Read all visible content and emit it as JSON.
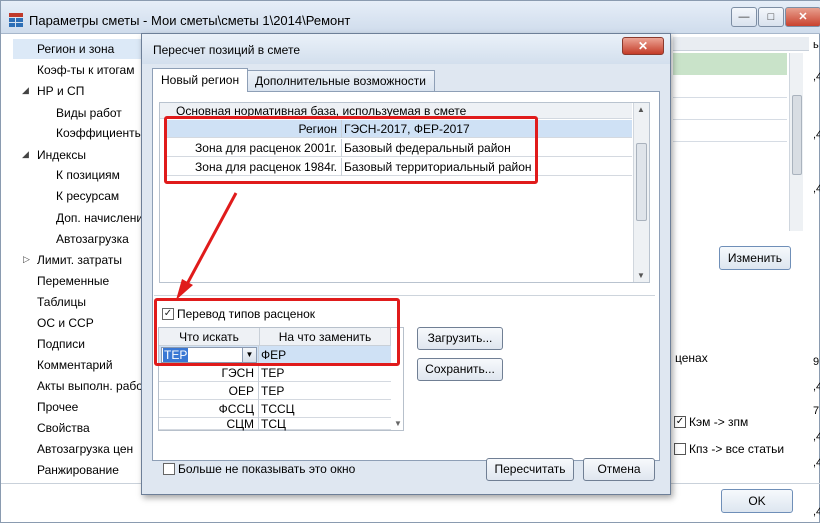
{
  "window": {
    "title": "Параметры сметы - Мои сметы\\сметы 1\\2014\\Ремонт",
    "min_glyph": "—",
    "max_glyph": "□",
    "close_glyph": "✕",
    "ok_label": "OK"
  },
  "sidebar": {
    "items": [
      {
        "label": "Регион и зона"
      },
      {
        "label": "Коэф-ты к итогам"
      },
      {
        "label": "НР и СП"
      },
      {
        "label": "Виды работ"
      },
      {
        "label": "Коэффициенты"
      },
      {
        "label": "Индексы"
      },
      {
        "label": "К позициям"
      },
      {
        "label": "К ресурсам"
      },
      {
        "label": "Доп. начислени"
      },
      {
        "label": "Автозагрузка"
      },
      {
        "label": "Лимит. затраты"
      },
      {
        "label": "Переменные"
      },
      {
        "label": "Таблицы"
      },
      {
        "label": "ОС и ССР"
      },
      {
        "label": "Подписи"
      },
      {
        "label": "Комментарий"
      },
      {
        "label": "Акты выполн. рабо"
      },
      {
        "label": "Прочее"
      },
      {
        "label": "Свойства"
      },
      {
        "label": "Автозагрузка цен"
      },
      {
        "label": "Ранжирование"
      }
    ]
  },
  "background": {
    "change_button": "Изменить",
    "text_tsenah": "ценах",
    "check_kem": "Кэм -> зпм",
    "check_kpz": "Кпз -> все статьи",
    "edge_marks": [
      "ь",
      ",4",
      ",4",
      ",4",
      "9,",
      ",4",
      "7,",
      ",4",
      ",4",
      ",4"
    ]
  },
  "dialog": {
    "title": "Пересчет позиций в смете",
    "close_glyph": "✕",
    "tabs": [
      "Новый регион",
      "Дополнительные возможности"
    ],
    "base_header": "Основная нормативная база, используемая в смете",
    "base_rows": [
      {
        "label": "Регион",
        "value": "ГЭСН-2017, ФЕР-2017"
      },
      {
        "label": "Зона для расценок 2001г.",
        "value": "Базовый федеральный район"
      },
      {
        "label": "Зона для расценок 1984г.",
        "value": "Базовый территориальный район"
      }
    ],
    "convert_checkbox_label": "Перевод типов расценок",
    "convert_checkbox_checked": true,
    "map_headers": [
      "Что искать",
      "На что заменить"
    ],
    "map_rows": [
      {
        "find": "ТЕР",
        "replace": "ФЕР"
      },
      {
        "find": "ГЭСН",
        "replace": "ТЕР"
      },
      {
        "find": "ОЕР",
        "replace": "ТЕР"
      },
      {
        "find": "ФССЦ",
        "replace": "ТССЦ"
      },
      {
        "find": "СЦМ",
        "replace": "ТСЦ"
      }
    ],
    "load_button": "Загрузить...",
    "save_button": "Сохранить...",
    "dont_show_label": "Больше не показывать это окно",
    "dont_show_checked": false,
    "recalc_button": "Пересчитать",
    "cancel_button": "Отмена"
  },
  "colors": {
    "annotation": "#e01b1b",
    "selection": "#cfe1f5",
    "accent_highlight": "#3a78d4"
  }
}
